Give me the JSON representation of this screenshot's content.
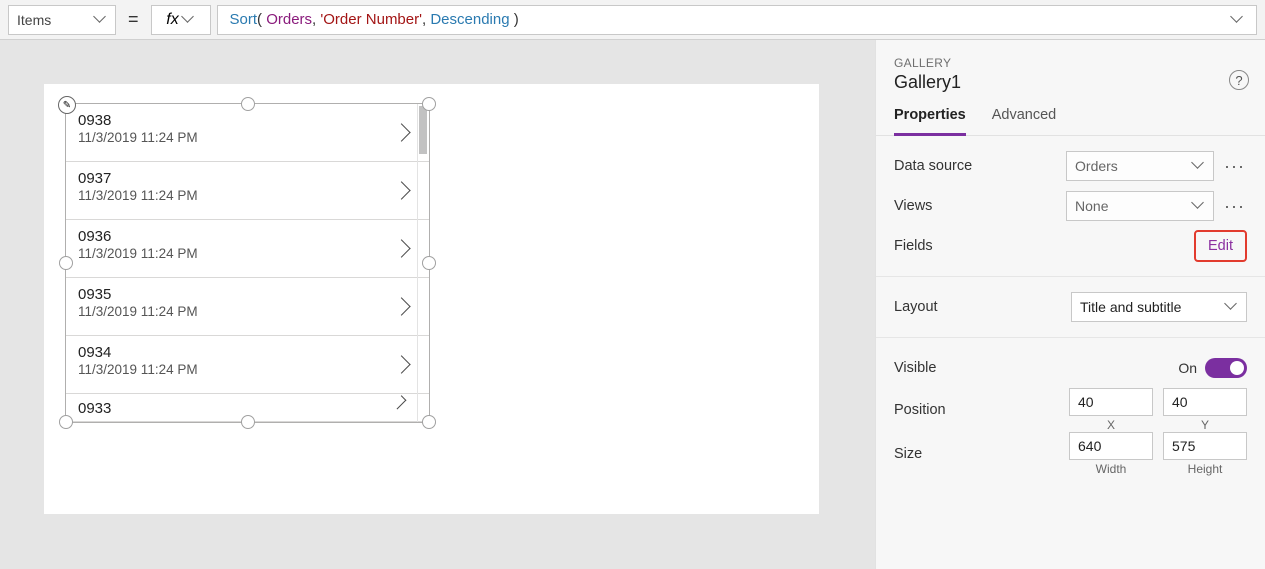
{
  "formula_bar": {
    "property": "Items",
    "fx_label": "fx",
    "equals": "=",
    "formula": {
      "fn": "Sort",
      "open": "( ",
      "ds": "Orders",
      "sep1": ", ",
      "lit": "'Order Number'",
      "sep2": ", ",
      "kw": "Descending",
      "close": " )"
    }
  },
  "gallery": {
    "edit_glyph": "✎",
    "items": [
      {
        "title": "0938",
        "subtitle": "11/3/2019 11:24 PM"
      },
      {
        "title": "0937",
        "subtitle": "11/3/2019 11:24 PM"
      },
      {
        "title": "0936",
        "subtitle": "11/3/2019 11:24 PM"
      },
      {
        "title": "0935",
        "subtitle": "11/3/2019 11:24 PM"
      },
      {
        "title": "0934",
        "subtitle": "11/3/2019 11:24 PM"
      },
      {
        "title": "0933",
        "subtitle": ""
      }
    ]
  },
  "panel": {
    "kind": "GALLERY",
    "name": "Gallery1",
    "help": "?",
    "tabs": {
      "properties": "Properties",
      "advanced": "Advanced"
    },
    "data_source": {
      "label": "Data source",
      "value": "Orders"
    },
    "views": {
      "label": "Views",
      "value": "None"
    },
    "fields": {
      "label": "Fields",
      "edit": "Edit"
    },
    "layout": {
      "label": "Layout",
      "value": "Title and subtitle"
    },
    "visible": {
      "label": "Visible",
      "state": "On"
    },
    "position": {
      "label": "Position",
      "x": "40",
      "y": "40",
      "xlabel": "X",
      "ylabel": "Y"
    },
    "size": {
      "label": "Size",
      "w": "640",
      "h": "575",
      "wlabel": "Width",
      "hlabel": "Height"
    },
    "ellipsis": "···"
  }
}
